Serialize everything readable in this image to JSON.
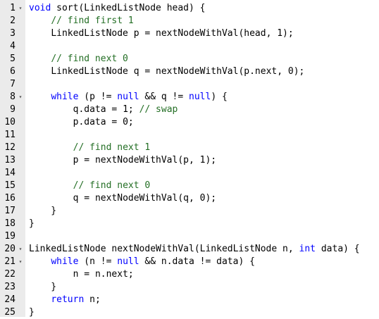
{
  "editor": {
    "colors": {
      "keyword": "#0000ff",
      "comment": "#236e24",
      "text": "#000000",
      "gutter_bg": "#ebebeb",
      "fold_marker": "#555555"
    },
    "lines": [
      {
        "num": "1",
        "fold": true,
        "code": "void sort(LinkedListNode head) {"
      },
      {
        "num": "2",
        "fold": false,
        "code": "    // find first 1"
      },
      {
        "num": "3",
        "fold": false,
        "code": "    LinkedListNode p = nextNodeWithVal(head, 1);"
      },
      {
        "num": "4",
        "fold": false,
        "code": ""
      },
      {
        "num": "5",
        "fold": false,
        "code": "    // find next 0"
      },
      {
        "num": "6",
        "fold": false,
        "code": "    LinkedListNode q = nextNodeWithVal(p.next, 0);"
      },
      {
        "num": "7",
        "fold": false,
        "code": ""
      },
      {
        "num": "8",
        "fold": true,
        "code": "    while (p != null && q != null) {"
      },
      {
        "num": "9",
        "fold": false,
        "code": "        q.data = 1; // swap"
      },
      {
        "num": "10",
        "fold": false,
        "code": "        p.data = 0;"
      },
      {
        "num": "11",
        "fold": false,
        "code": ""
      },
      {
        "num": "12",
        "fold": false,
        "code": "        // find next 1"
      },
      {
        "num": "13",
        "fold": false,
        "code": "        p = nextNodeWithVal(p, 1);"
      },
      {
        "num": "14",
        "fold": false,
        "code": ""
      },
      {
        "num": "15",
        "fold": false,
        "code": "        // find next 0"
      },
      {
        "num": "16",
        "fold": false,
        "code": "        q = nextNodeWithVal(q, 0);"
      },
      {
        "num": "17",
        "fold": false,
        "code": "    }"
      },
      {
        "num": "18",
        "fold": false,
        "code": "}"
      },
      {
        "num": "19",
        "fold": false,
        "code": ""
      },
      {
        "num": "20",
        "fold": true,
        "code": "LinkedListNode nextNodeWithVal(LinkedListNode n, int data) {"
      },
      {
        "num": "21",
        "fold": true,
        "code": "    while (n != null && n.data != data) {"
      },
      {
        "num": "22",
        "fold": false,
        "code": "        n = n.next;"
      },
      {
        "num": "23",
        "fold": false,
        "code": "    }"
      },
      {
        "num": "24",
        "fold": false,
        "code": "    return n;"
      },
      {
        "num": "25",
        "fold": false,
        "code": "}"
      }
    ],
    "fold_glyph": "▾"
  }
}
